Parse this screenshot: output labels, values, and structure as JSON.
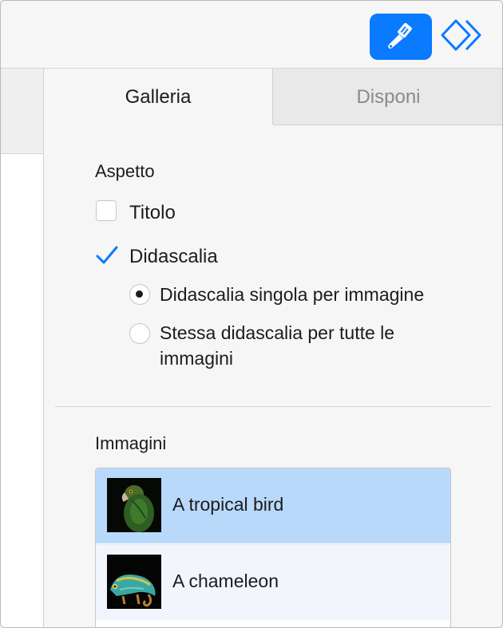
{
  "toolbar": {
    "format_icon": "paintbrush-icon",
    "arrange_icon": "arrange-diamonds-icon",
    "accent_color": "#0a7aff"
  },
  "tabs": [
    {
      "label": "Galleria",
      "active": true
    },
    {
      "label": "Disponi",
      "active": false
    }
  ],
  "aspetto": {
    "title": "Aspetto",
    "titolo": {
      "label": "Titolo",
      "checked": false
    },
    "didascalia": {
      "label": "Didascalia",
      "checked": true
    },
    "caption_options": [
      {
        "label": "Didascalia singola per immagine",
        "selected": true
      },
      {
        "label_line1": "Stessa didascalia per tutte le",
        "label_line2": "immagini",
        "selected": false
      }
    ]
  },
  "immagini": {
    "title": "Immagini",
    "items": [
      {
        "label": "A tropical bird",
        "thumbnail": "parrot-photo",
        "selected": true
      },
      {
        "label": "A chameleon",
        "thumbnail": "chameleon-photo",
        "selected": false
      }
    ]
  }
}
